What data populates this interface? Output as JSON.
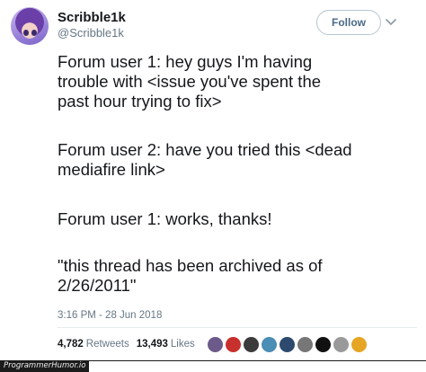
{
  "user": {
    "display_name": "Scribble1k",
    "handle": "@Scribble1k",
    "avatar_icon": "anime-girl-avatar"
  },
  "follow_label": "Follow",
  "menu_icon": "chevron-down-icon",
  "tweet": {
    "paragraphs": [
      [
        "Forum user 1: hey guys I'm having",
        "trouble with <issue you've spent the",
        "past hour trying to fix>"
      ],
      [
        "Forum user 2: have you tried this <dead",
        "mediafire link>"
      ],
      [
        "Forum user 1: works,  thanks!"
      ],
      [
        "\"this thread has been archived as of",
        "2/26/2011\""
      ]
    ]
  },
  "timestamp": "3:16 PM - 28 Jun 2018",
  "stats": {
    "retweets_count": "4,782",
    "retweets_label": "Retweets",
    "likes_count": "13,493",
    "likes_label": "Likes"
  },
  "likers": [
    {
      "color": "#6c5a8a"
    },
    {
      "color": "#c8302e"
    },
    {
      "color": "#3b3b3b"
    },
    {
      "color": "#4a8db5"
    },
    {
      "color": "#2d4a6e"
    },
    {
      "color": "#777777"
    },
    {
      "color": "#111111"
    },
    {
      "color": "#9a9a9a"
    },
    {
      "color": "#e6a623"
    }
  ],
  "watermark": "ProgrammerHumor.io"
}
